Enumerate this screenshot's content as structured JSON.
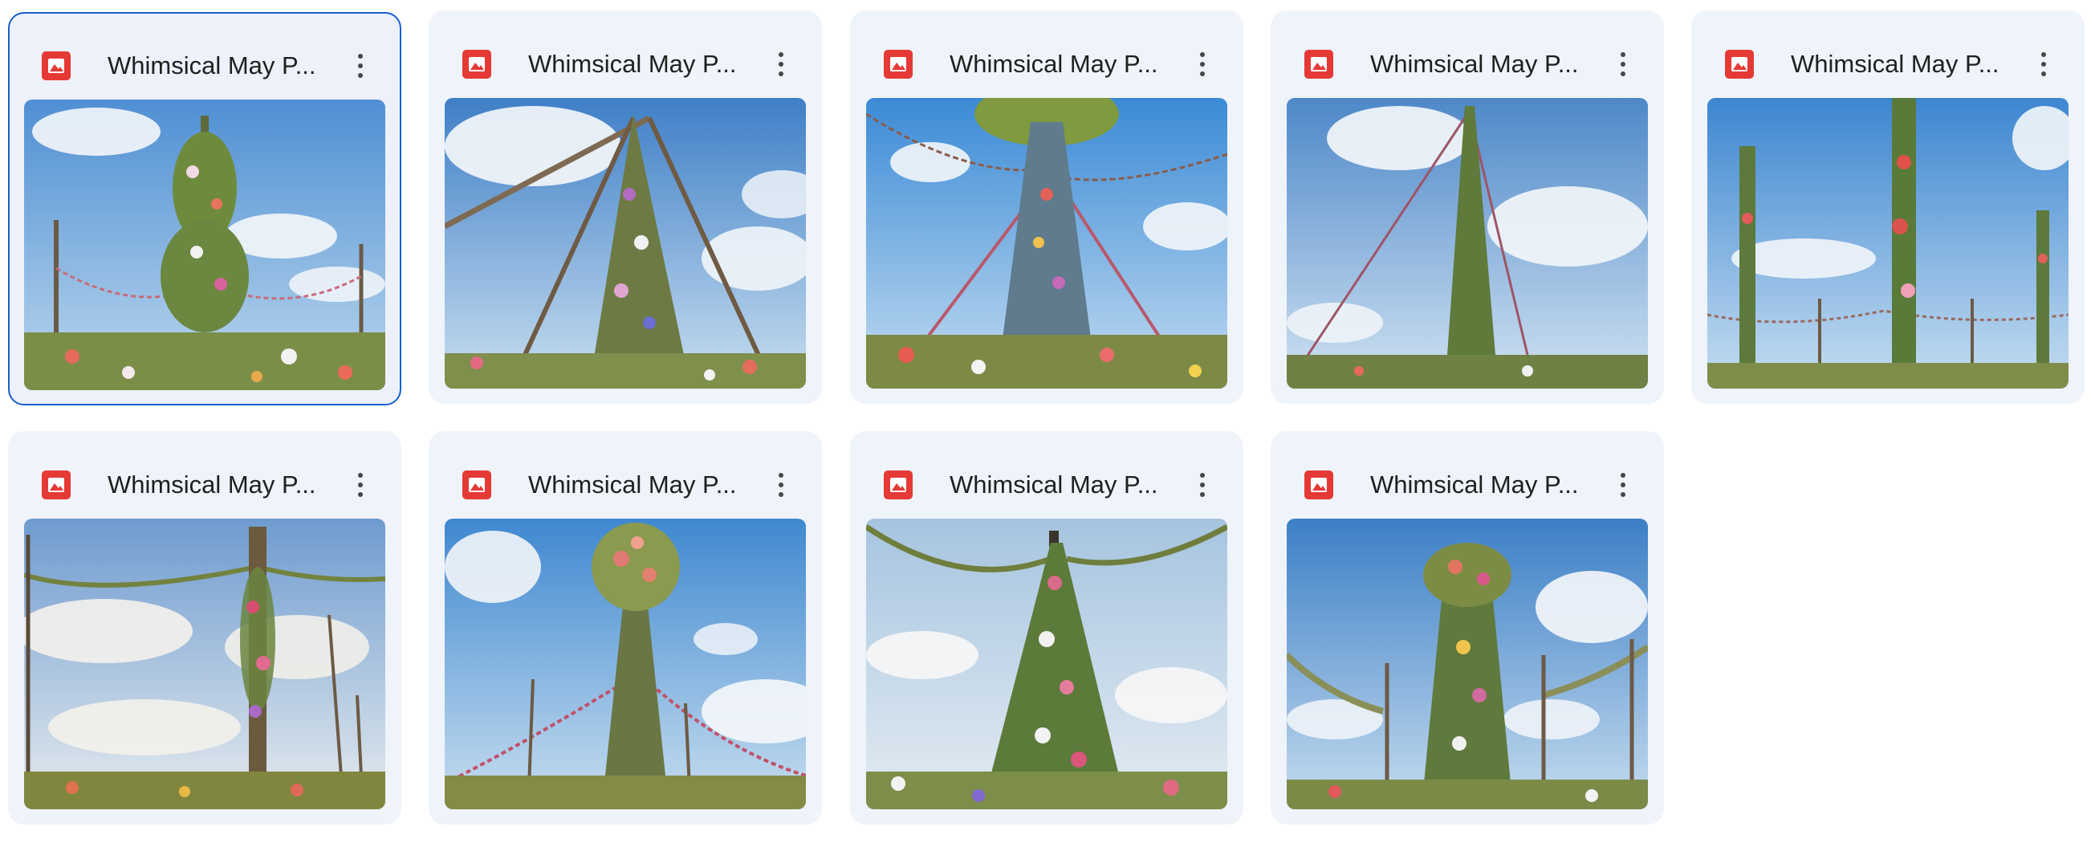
{
  "files": [
    {
      "name": "Whimsical May P...",
      "selected": true
    },
    {
      "name": "Whimsical May P...",
      "selected": false
    },
    {
      "name": "Whimsical May P...",
      "selected": false
    },
    {
      "name": "Whimsical May P...",
      "selected": false
    },
    {
      "name": "Whimsical May P...",
      "selected": false
    },
    {
      "name": "Whimsical May P...",
      "selected": false
    },
    {
      "name": "Whimsical May P...",
      "selected": false
    },
    {
      "name": "Whimsical May P...",
      "selected": false
    },
    {
      "name": "Whimsical May P...",
      "selected": false
    }
  ],
  "icons": {
    "file_type": "image-file-icon",
    "menu": "more-vert-icon"
  },
  "colors": {
    "card_background": "#eff3fa",
    "selected_border": "#1a5fd0",
    "file_icon": "#e53935",
    "text": "#1f1f1f",
    "sky_top": "#4f8fd3",
    "sky_bottom": "#bcd8ee"
  }
}
